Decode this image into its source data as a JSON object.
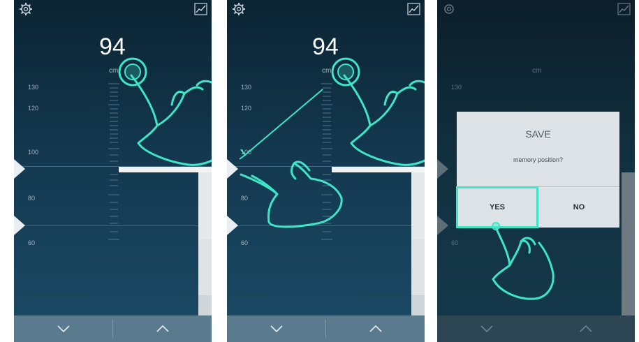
{
  "height": {
    "value": "94",
    "unit": "cm"
  },
  "scale_labels": [
    "130",
    "120",
    "100",
    "80",
    "60"
  ],
  "footer": {
    "down_icon": "chevron-down-icon",
    "up_icon": "chevron-up-icon"
  },
  "header": {
    "settings_icon": "gear-icon",
    "chart_icon": "chart-icon"
  },
  "dialog": {
    "title": "SAVE",
    "message": "memory position?",
    "yes_label": "YES",
    "no_label": "NO"
  },
  "colors": {
    "accent": "#3ee5c6",
    "background": "#13384f",
    "footer": "#5a7a8e"
  }
}
